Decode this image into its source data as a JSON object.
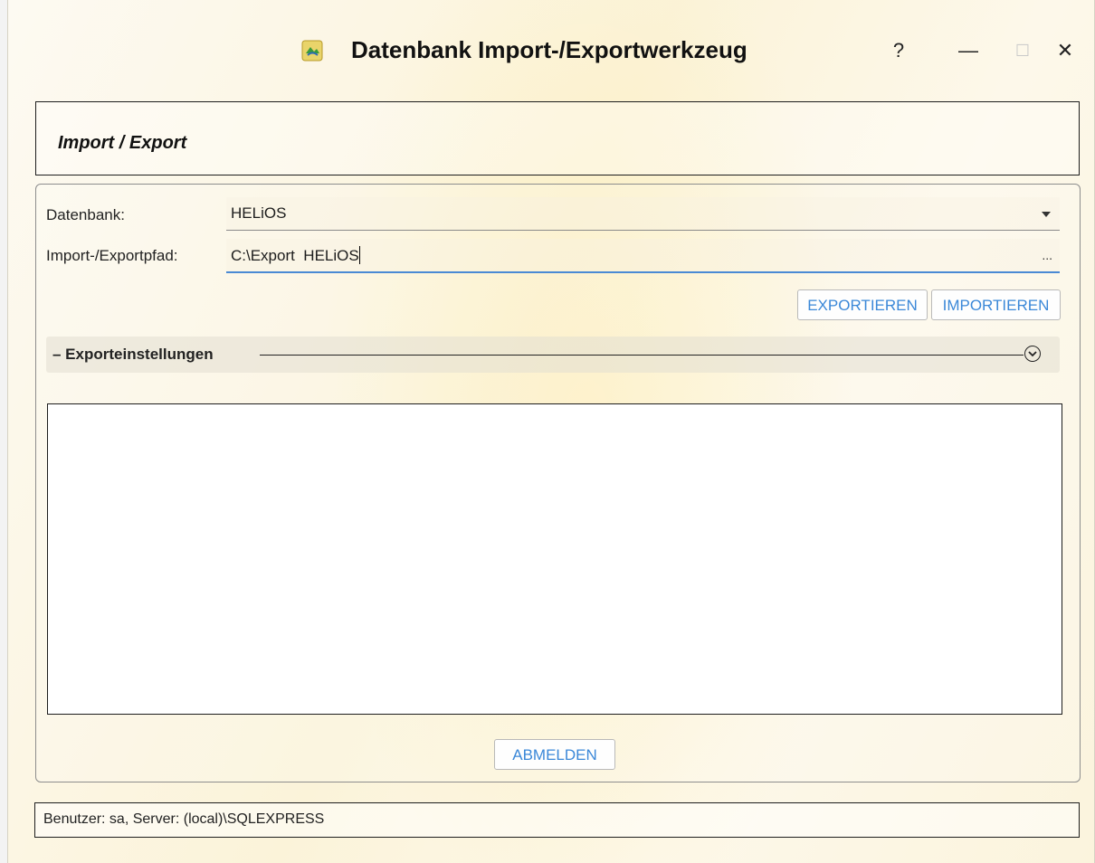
{
  "window": {
    "title": "Datenbank Import-/Exportwerkzeug",
    "help_label": "?",
    "minimize_label": "—",
    "maximize_label": "☐",
    "close_label": "✕"
  },
  "header": {
    "title": "Import / Export"
  },
  "form": {
    "database_label": "Datenbank:",
    "database_value": "HELiOS",
    "path_label": "Import-/Exportpfad:",
    "path_value": "C:\\Export  HELiOS",
    "browse_label": "..."
  },
  "actions": {
    "export_label": "EXPORTIEREN",
    "import_label": "IMPORTIEREN",
    "logout_label": "ABMELDEN"
  },
  "export_settings": {
    "title": "– Exporteinstellungen"
  },
  "status": {
    "text": "Benutzer: sa, Server: (local)\\SQLEXPRESS"
  },
  "colors": {
    "accent": "#3b88d8",
    "focus_underline": "#4a8ad4"
  },
  "icons": {
    "app": "database-app-icon",
    "collapse": "chevron-circle-icon",
    "dropdown": "caret-down-icon"
  }
}
